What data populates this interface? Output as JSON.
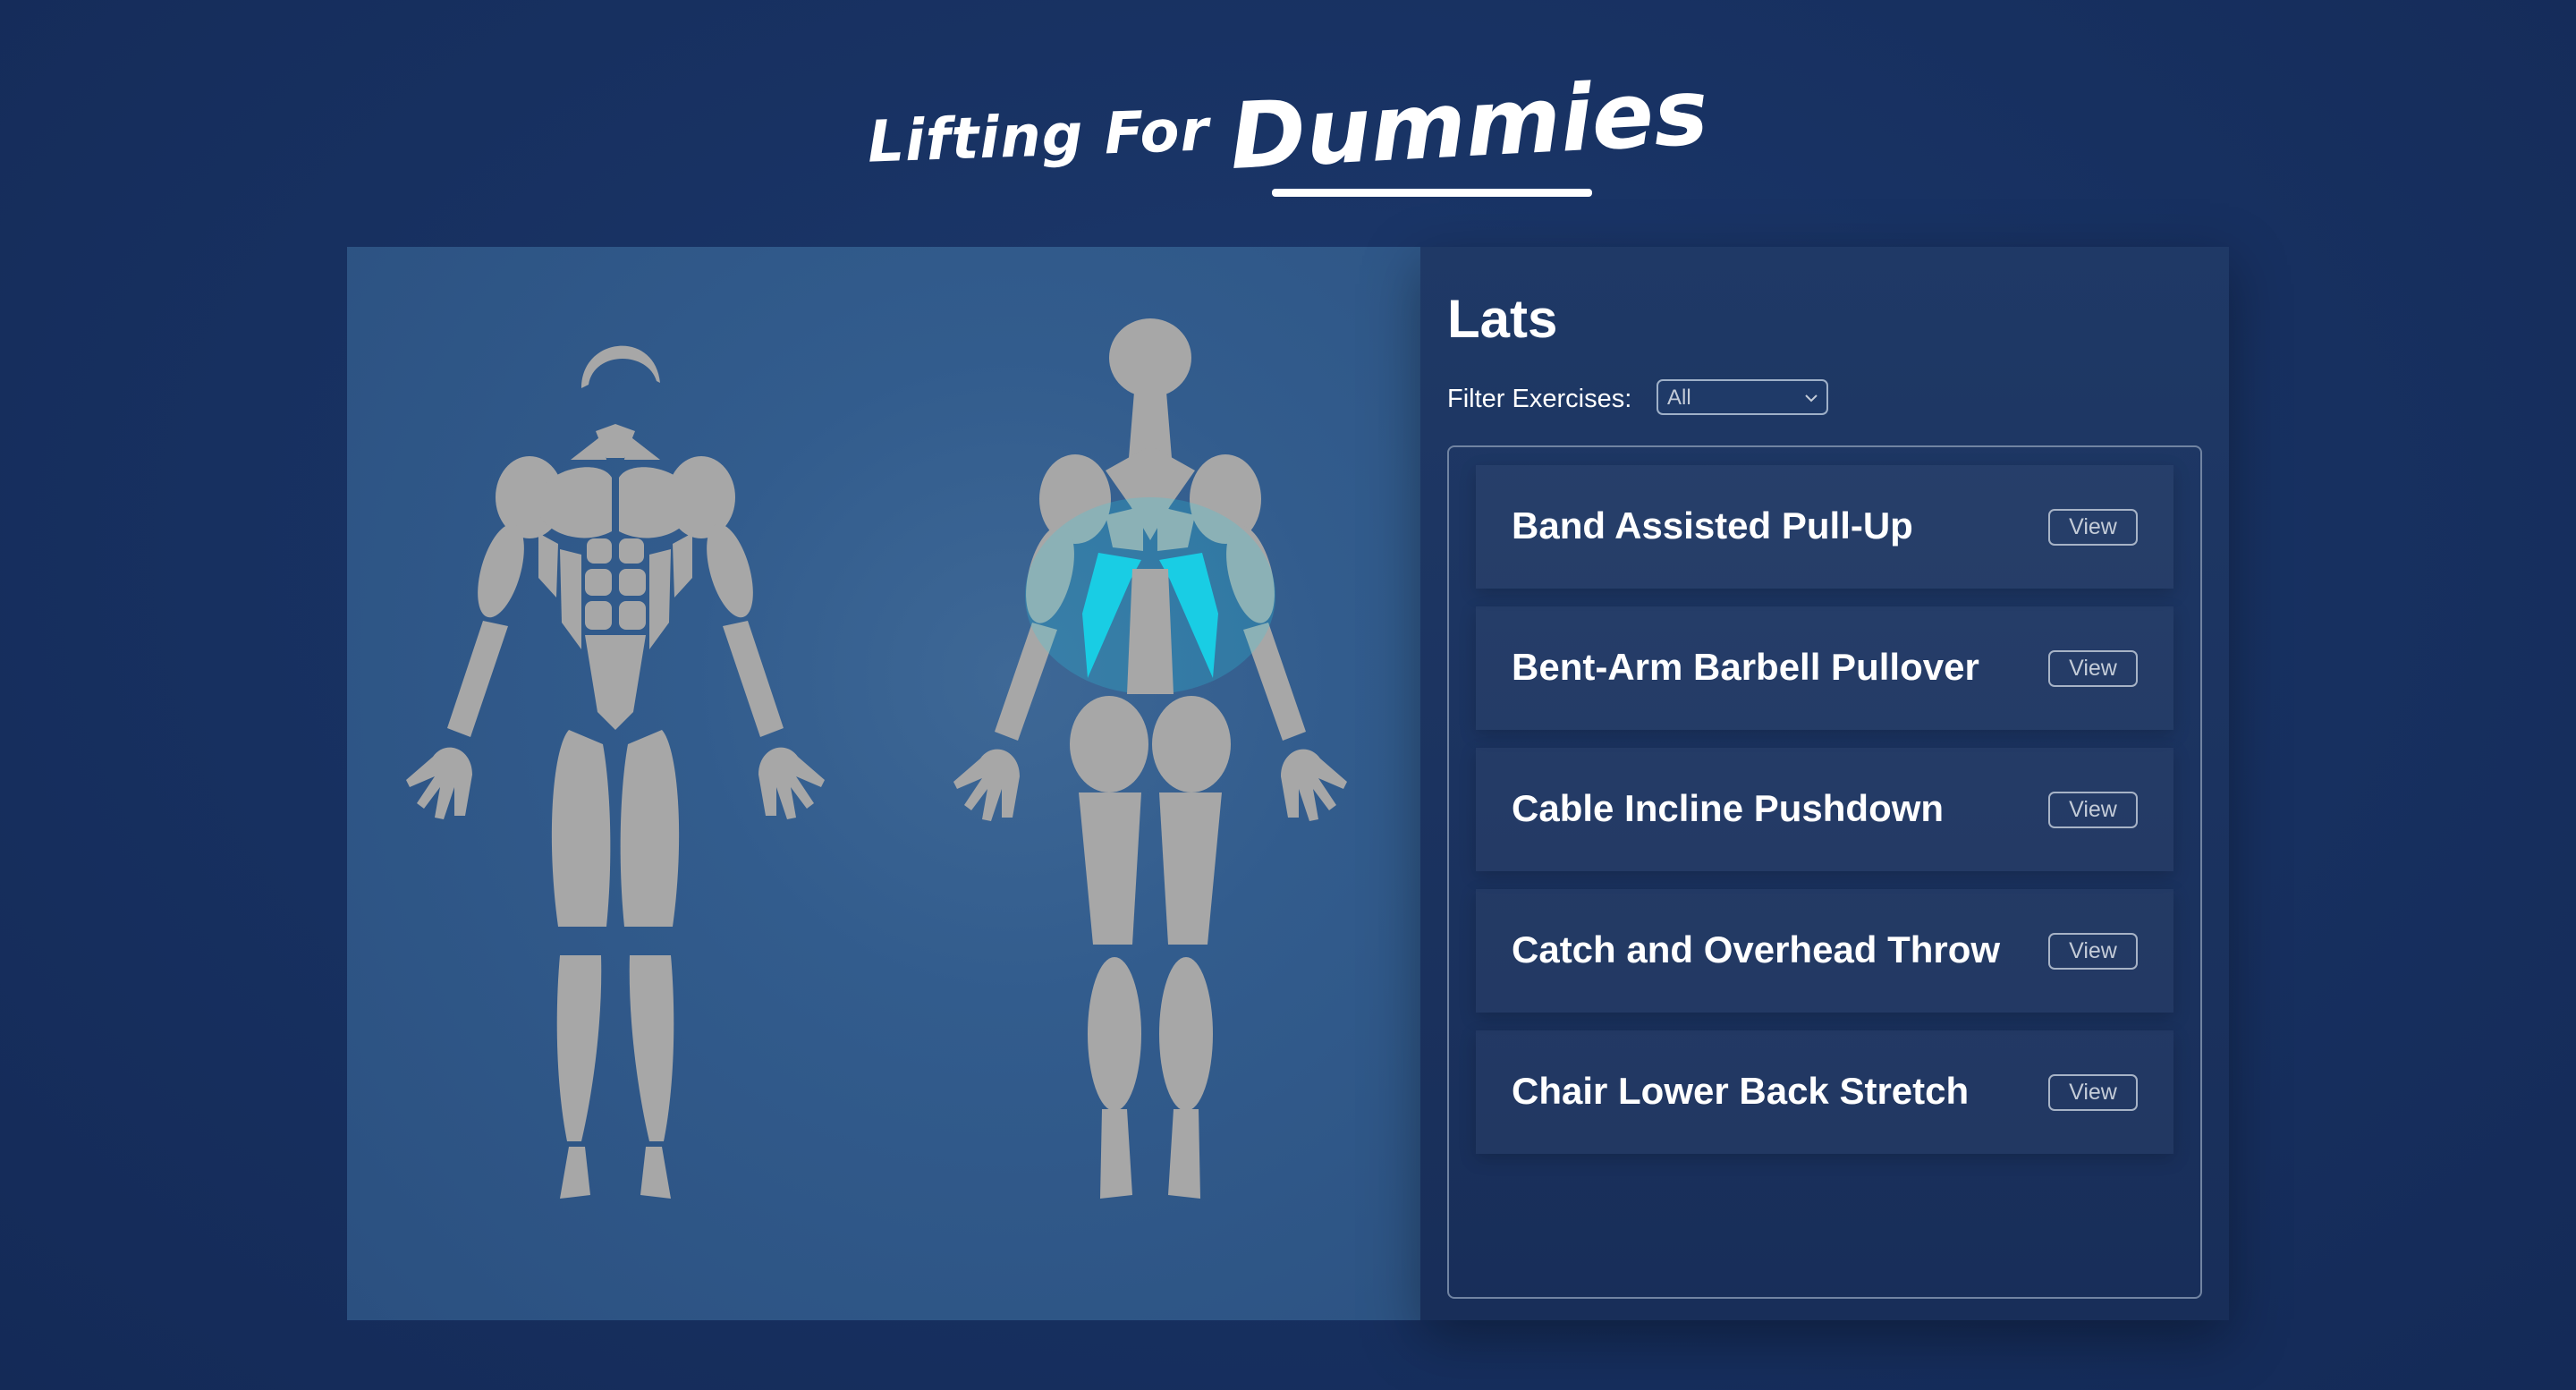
{
  "header": {
    "title_prefix": "Lifting For",
    "title_main": "Dummies"
  },
  "selected_muscle": {
    "name": "Lats",
    "highlight_color": "#19cde4"
  },
  "filter": {
    "label": "Filter Exercises:",
    "selected": "All"
  },
  "exercises": [
    {
      "name": "Band Assisted Pull-Up",
      "action": "View"
    },
    {
      "name": "Bent-Arm Barbell Pullover",
      "action": "View"
    },
    {
      "name": "Cable Incline Pushdown",
      "action": "View"
    },
    {
      "name": "Catch and Overhead Throw",
      "action": "View"
    },
    {
      "name": "Chair Lower Back Stretch",
      "action": "View"
    }
  ],
  "colors": {
    "background": "#183263",
    "body_panel": "#325c8d",
    "muscle_fill": "#a7a7a7",
    "highlight": "#19cde4"
  }
}
